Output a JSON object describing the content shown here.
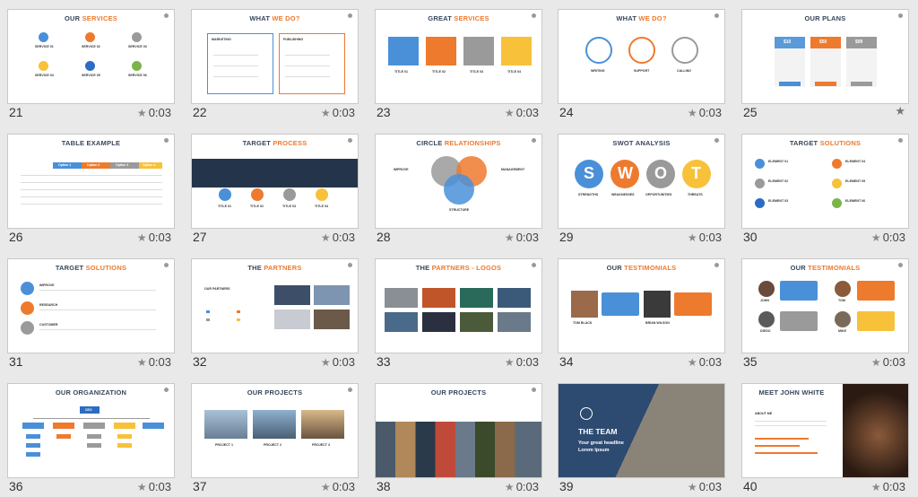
{
  "slides": [
    {
      "number": "21",
      "title": "OUR ",
      "title_hl": "SERVICES",
      "duration": "0:03",
      "labels": [
        "SERVICE 01",
        "SERVICE 02",
        "SERVICE 03",
        "SERVICE 04",
        "SERVICE 05",
        "SERVICE 06"
      ]
    },
    {
      "number": "22",
      "title": "WHAT ",
      "title_hl": "WE DO?",
      "duration": "0:03",
      "labels": [
        "MARKETING",
        "PUBLISHING"
      ]
    },
    {
      "number": "23",
      "title": "GREAT ",
      "title_hl": "SERVICES",
      "duration": "0:03",
      "labels": [
        "TITLE 01",
        "TITLE 02",
        "TITLE 03",
        "TITLE 04"
      ]
    },
    {
      "number": "24",
      "title": "WHAT ",
      "title_hl": "WE DO?",
      "duration": "0:03",
      "labels": [
        "WRITING",
        "SUPPORT",
        "CALLING"
      ]
    },
    {
      "number": "25",
      "title": "OUR PLANS",
      "title_hl": "",
      "duration": "",
      "labels": [
        "$10",
        "$50",
        "$99"
      ]
    },
    {
      "number": "26",
      "title": "TABLE EXAMPLE",
      "title_hl": "",
      "duration": "0:03",
      "labels": [
        "Option 1",
        "Option 2",
        "Option 3",
        "Option 4"
      ]
    },
    {
      "number": "27",
      "title": "TARGET ",
      "title_hl": "PROCESS",
      "duration": "0:03",
      "labels": [
        "TITLE 01",
        "TITLE 02",
        "TITLE 03",
        "TITLE 04"
      ]
    },
    {
      "number": "28",
      "title": "CIRCLE ",
      "title_hl": "RELATIONSHIPS",
      "duration": "0:03",
      "labels": [
        "IMPROVE",
        "MANAGEMENT",
        "STRUCTURE"
      ]
    },
    {
      "number": "29",
      "title": "SWOT ANALYSIS",
      "title_hl": "",
      "duration": "0:03",
      "labels": [
        "S",
        "W",
        "O",
        "T",
        "STRENGTHS",
        "WEAKNESSES",
        "OPPORTUNITIES",
        "THREATS"
      ]
    },
    {
      "number": "30",
      "title": "TARGET ",
      "title_hl": "SOLUTIONS",
      "duration": "0:03",
      "labels": [
        "ELEMENT 01",
        "ELEMENT 02",
        "ELEMENT 03",
        "ELEMENT 04",
        "ELEMENT 05",
        "ELEMENT 06"
      ]
    },
    {
      "number": "31",
      "title": "TARGET ",
      "title_hl": "SOLUTIONS",
      "duration": "0:03",
      "labels": [
        "IMPROVE",
        "RESEARCH",
        "CUSTOMER"
      ]
    },
    {
      "number": "32",
      "title": "THE ",
      "title_hl": "PARTNERS",
      "duration": "0:03",
      "labels": [
        "OUR PARTNERS"
      ]
    },
    {
      "number": "33",
      "title": "THE ",
      "title_hl": "PARTNERS - LOGOS",
      "duration": "0:03",
      "labels": []
    },
    {
      "number": "34",
      "title": "OUR ",
      "title_hl": "TESTIMONIALS",
      "duration": "0:03",
      "labels": [
        "TOM BLACK",
        "BRIAN WILSON"
      ]
    },
    {
      "number": "35",
      "title": "OUR ",
      "title_hl": "TESTIMONIALS",
      "duration": "0:03",
      "labels": [
        "JOHN",
        "TOM",
        "DIEGO",
        "MIKE"
      ]
    },
    {
      "number": "36",
      "title": "OUR ORGANIZATION",
      "title_hl": "",
      "duration": "0:03",
      "labels": [
        "CEO"
      ]
    },
    {
      "number": "37",
      "title": "OUR PROJECTS",
      "title_hl": "",
      "duration": "0:03",
      "labels": [
        "PROJECT 1",
        "PROJECT 2",
        "PROJECT 3"
      ]
    },
    {
      "number": "38",
      "title": "OUR PROJECTS",
      "title_hl": "",
      "duration": "0:03",
      "labels": []
    },
    {
      "number": "39",
      "title": "THE TEAM",
      "title_hl": "",
      "duration": "0:03",
      "labels": [
        "Your great headline",
        "Lorem Ipsum"
      ]
    },
    {
      "number": "40",
      "title": "MEET JOHN WHITE",
      "title_hl": "",
      "duration": "0:03",
      "labels": [
        "ABOUT ME"
      ]
    }
  ]
}
